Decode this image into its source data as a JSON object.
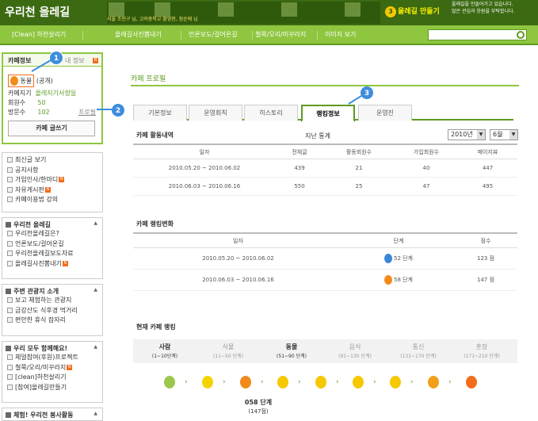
{
  "header": {
    "logo": "우리천 올레길",
    "logo_sub": "우리",
    "promo_text": "서울 조민구 님, 고려중학교 황영현, 정순애 님",
    "make_label": "올레길 만들기",
    "make_num": "3",
    "slogan": "올레길을 만들어가고 있습니다.\n많은 관심과 응원을 부탁합니다."
  },
  "nav": {
    "items": [
      "[Clean] 하천살리기",
      "올레길사진뽐내기",
      "언론보도/걸어온길",
      "철쭉/오리/미꾸라지",
      "이미지 보기"
    ],
    "search_placeholder": ""
  },
  "cafe_info": {
    "tab_info": "카페정보",
    "tab_mine": "내 정보",
    "level_name": "동물",
    "level_public": "(공개)",
    "rows": [
      {
        "label": "카페지기",
        "value": "올레지기서정일"
      },
      {
        "label": "회원수",
        "value": "50"
      },
      {
        "label": "방문수",
        "value": "102"
      }
    ],
    "profile_link": "프로필",
    "write_button": "카페 글쓰기"
  },
  "callouts": [
    "1",
    "2",
    "3"
  ],
  "menus": [
    {
      "title": "",
      "items": [
        "최신글 보기",
        "공지사항",
        "가입인사/한마디",
        "자유게시판",
        "카페이용법 강의"
      ]
    },
    {
      "title": "우리천 올레길",
      "items": [
        "우리천올레길은?",
        "언론보도/걸어온길",
        "우리천올레길보도자료",
        "올레길사진뽐내기"
      ]
    },
    {
      "title": "주변 관광지 소개",
      "items": [
        "보고 체험하는 관광지",
        "금강산도 식후경 먹거리",
        "편안한 휴식 잠자리"
      ]
    },
    {
      "title": "우리 모두 함께해요!",
      "items": [
        "체얼참여(후원)프로젝트",
        "철쭉/오리/미꾸라지",
        "[clean]하천살리기",
        "[참여]올레길만들기"
      ]
    },
    {
      "title": "체험! 우리천 봉사활동",
      "items": []
    }
  ],
  "main": {
    "title": "카페 프로필",
    "tabs": [
      "기본정보",
      "운영회칙",
      "히스토리",
      "랭킹정보",
      "운영진"
    ],
    "active_tab": 3,
    "activity": {
      "title": "카페 활동내역",
      "period_label": "지난 통계",
      "year": "2010년",
      "month": "6월",
      "headers": [
        "일자",
        "전체글",
        "활동회원수",
        "가입회원수",
        "페이지뷰"
      ],
      "rows": [
        [
          "2010.05.20 ~ 2010.06.02",
          "439",
          "21",
          "40",
          "447"
        ],
        [
          "2010.06.03 ~ 2010.06.16",
          "550",
          "25",
          "47",
          "495"
        ]
      ]
    },
    "ranking_change": {
      "title": "카페 랭킹변화",
      "headers": [
        "일자",
        "단계",
        "점수"
      ],
      "rows": [
        {
          "date": "2010.05.20 ~ 2010.06.02",
          "stage": "52 단계",
          "score": "123 점",
          "color": "#3a86d8"
        },
        {
          "date": "2010.06.03 ~ 2010.06.16",
          "stage": "58 단계",
          "score": "147 점",
          "color": "#f28a1a"
        }
      ]
    },
    "current_rank": {
      "title": "현재 카페 랭킹",
      "levels": [
        {
          "name": "사람",
          "range": "(1~10단계)"
        },
        {
          "name": "식물",
          "range": "(11~50 단계)"
        },
        {
          "name": "동물",
          "range": "(51~90 단계)"
        },
        {
          "name": "음식",
          "range": "(91~130 단계)"
        },
        {
          "name": "통신",
          "range": "(131~170 단계)"
        },
        {
          "name": "훈장",
          "range": "(171~210 단계)"
        }
      ],
      "egg_colors": [
        "#9bc84a",
        "#f5d300",
        "#f28a1a",
        "#f5c800",
        "#f5c800",
        "#f5c800",
        "#f5c800",
        "#f2a01a",
        "#f26c1a"
      ],
      "current_stage": "058 단계",
      "current_rank": "(147점)"
    }
  }
}
